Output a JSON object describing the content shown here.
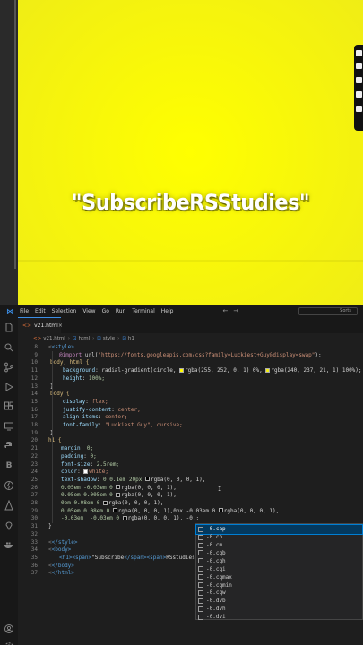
{
  "preview": {
    "heading": "\"SubscribeRSStudies\""
  },
  "editor": {
    "menu": [
      "File",
      "Edit",
      "Selection",
      "View",
      "Go",
      "Run",
      "Terminal",
      "Help"
    ],
    "search_label": "Sorts",
    "tab_label": "v21.html",
    "breadcrumb": [
      "v21.html",
      "html",
      "style",
      "h1"
    ],
    "lines": [
      {
        "n": "8",
        "ind": 0
      },
      {
        "n": "9",
        "ind": 1
      },
      {
        "n": "10",
        "ind": 0
      },
      {
        "n": "11",
        "ind": 1
      },
      {
        "n": "12",
        "ind": 1
      },
      {
        "n": "13",
        "ind": 0
      },
      {
        "n": "14",
        "ind": 0
      },
      {
        "n": "15",
        "ind": 1
      },
      {
        "n": "16",
        "ind": 1
      },
      {
        "n": "17",
        "ind": 1
      },
      {
        "n": "18",
        "ind": 1
      },
      {
        "n": "19",
        "ind": 0
      },
      {
        "n": "20",
        "ind": 0
      },
      {
        "n": "21",
        "ind": 1
      },
      {
        "n": "22",
        "ind": 1
      },
      {
        "n": "23",
        "ind": 1
      },
      {
        "n": "24",
        "ind": 1
      },
      {
        "n": "25",
        "ind": 1
      },
      {
        "n": "26",
        "ind": 1
      },
      {
        "n": "27",
        "ind": 1
      },
      {
        "n": "28",
        "ind": 1
      },
      {
        "n": "29",
        "ind": 1
      },
      {
        "n": "30",
        "ind": 1
      },
      {
        "n": "31",
        "ind": 0
      },
      {
        "n": "32",
        "ind": 0
      },
      {
        "n": "33",
        "ind": 0
      },
      {
        "n": "34",
        "ind": 0
      },
      {
        "n": "35",
        "ind": 1
      },
      {
        "n": "36",
        "ind": 0
      },
      {
        "n": "37",
        "ind": 0
      }
    ],
    "code": {
      "l8": "<style>",
      "l9_a": "@import",
      "l9_b": " url(",
      "l9_c": "\"https://fonts.googleapis.com/css?family=Luckiest+Guy&display=swap\"",
      "l9_d": ");",
      "l10": "body, html {",
      "l11_p": "background",
      "l11_v1": " radial-gradient(circle, ",
      "l11_v2": "rgba(255, 252, 0, 1) 0%, ",
      "l11_v3": "rgba(240, 237, 21, 1) 100%);",
      "l12_p": "height",
      "l12_v": " 100%;",
      "l13": "}",
      "l14": "body {",
      "l15_p": "display",
      "l15_v": " flex;",
      "l16_p": "justify-content",
      "l16_v": " center;",
      "l17_p": "align-items",
      "l17_v": " center;",
      "l18_p": "font-family",
      "l18_v": " \"Luckiest Guy\", cursive;",
      "l19": "}",
      "l20": "h1 {",
      "l21_p": "margin",
      "l21_v": " 0;",
      "l22_p": "padding",
      "l22_v": " 0;",
      "l23_p": "font-size",
      "l23_v": " 2.5rem;",
      "l24_p": "color",
      "l24_v": "white;",
      "l25_p": "text-shadow",
      "l25_v": " 0 0.1em 20px ",
      "l25_w": "rgba(0, 0, 0, 1),",
      "l26_v": "0.05em -0.03em 0 ",
      "l26_w": "rgba(0, 0, 0, 1),",
      "l27_v": "0.05em 0.005em 0 ",
      "l27_w": "rgba(0, 0, 0, 1),",
      "l28_v": "0em 0.08em 0 ",
      "l28_w": "rgba(0, 0, 0, 1),",
      "l29_v": "0.05em 0.08em 0 ",
      "l29_w": "rgba(0, 0, 0, 1),0px -0.03em 0 ",
      "l29_x": "rgba(0, 0, 0, 1),",
      "l30_v": "-0.03em  -0.03em 0 ",
      "l30_w": "rgba(0, 0, 0, 1), -0.;",
      "l31": "}",
      "l33": "</style>",
      "l34": "<body>",
      "l35_a": "<h1><span>",
      "l35_b": "\"Subscribe",
      "l35_c": "</span><span>",
      "l35_d": "RSstudies",
      "l36": "</body>",
      "l37": "</html>"
    },
    "suggestions": [
      "-0.cap",
      "-0.ch",
      "-0.cm",
      "-0.cqb",
      "-0.cqh",
      "-0.cqi",
      "-0.cqmax",
      "-0.cqmin",
      "-0.cqw",
      "-0.dvb",
      "-0.dvh",
      "-0.dvi"
    ],
    "cursor_glyph": "I"
  }
}
